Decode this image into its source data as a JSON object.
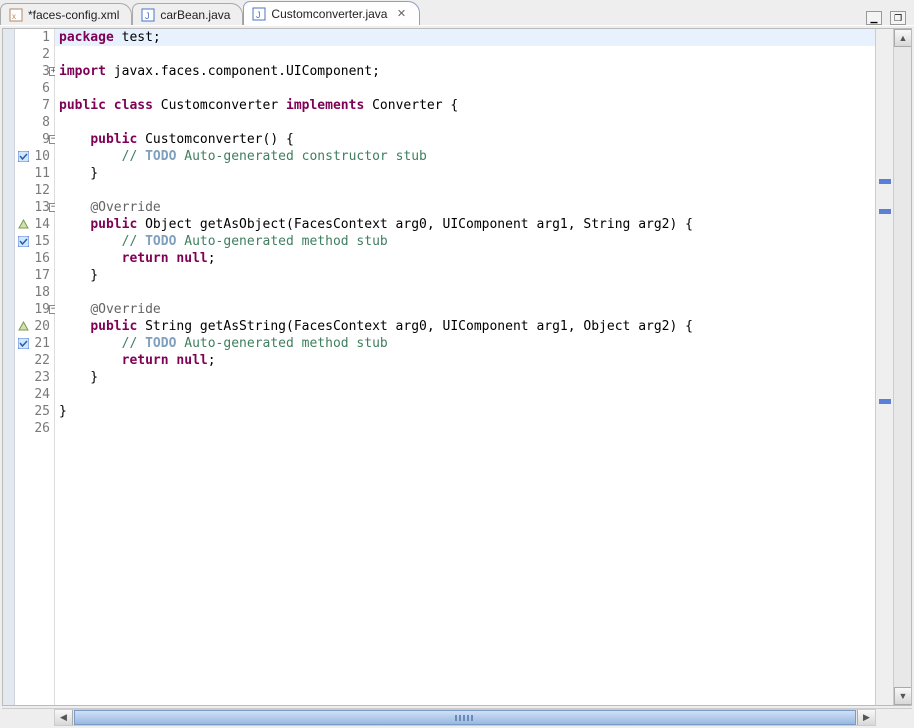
{
  "tabs": [
    {
      "label": "*faces-config.xml",
      "icon": "xml-file-icon",
      "active": false
    },
    {
      "label": "carBean.java",
      "icon": "java-file-icon",
      "active": false
    },
    {
      "label": "Customconverter.java",
      "icon": "java-file-icon",
      "active": true
    }
  ],
  "code": {
    "lines": [
      {
        "n": "1",
        "fold": "",
        "mark": "",
        "tokens": [
          [
            "kw",
            "package"
          ],
          [
            "",
            " test;"
          ]
        ],
        "cur": true
      },
      {
        "n": "2",
        "fold": "",
        "mark": "",
        "tokens": []
      },
      {
        "n": "3",
        "fold": "+",
        "mark": "",
        "tokens": [
          [
            "kw",
            "import"
          ],
          [
            "",
            " javax.faces.component.UIComponent;"
          ]
        ]
      },
      {
        "n": "6",
        "fold": "",
        "mark": "",
        "tokens": []
      },
      {
        "n": "7",
        "fold": "",
        "mark": "",
        "tokens": [
          [
            "kw",
            "public"
          ],
          [
            "",
            " "
          ],
          [
            "kw",
            "class"
          ],
          [
            "",
            " Customconverter "
          ],
          [
            "kw",
            "implements"
          ],
          [
            "",
            " Converter {"
          ]
        ]
      },
      {
        "n": "8",
        "fold": "",
        "mark": "",
        "tokens": []
      },
      {
        "n": "9",
        "fold": "-",
        "mark": "",
        "tokens": [
          [
            "",
            "    "
          ],
          [
            "kw",
            "public"
          ],
          [
            "",
            " Customconverter() {"
          ]
        ]
      },
      {
        "n": "10",
        "fold": "",
        "mark": "chk",
        "tokens": [
          [
            "",
            "        "
          ],
          [
            "cmt",
            "// "
          ],
          [
            "todo",
            "TODO"
          ],
          [
            "cmt",
            " Auto-generated constructor stub"
          ]
        ]
      },
      {
        "n": "11",
        "fold": "",
        "mark": "",
        "tokens": [
          [
            "",
            "    }"
          ]
        ]
      },
      {
        "n": "12",
        "fold": "",
        "mark": "",
        "tokens": []
      },
      {
        "n": "13",
        "fold": "-",
        "mark": "",
        "tokens": [
          [
            "",
            "    "
          ],
          [
            "ann",
            "@Override"
          ]
        ]
      },
      {
        "n": "14",
        "fold": "",
        "mark": "tri",
        "tokens": [
          [
            "",
            "    "
          ],
          [
            "kw",
            "public"
          ],
          [
            "",
            " Object getAsObject(FacesContext arg0, UIComponent arg1, String arg2) {"
          ]
        ]
      },
      {
        "n": "15",
        "fold": "",
        "mark": "chk",
        "tokens": [
          [
            "",
            "        "
          ],
          [
            "cmt",
            "// "
          ],
          [
            "todo",
            "TODO"
          ],
          [
            "cmt",
            " Auto-generated method stub"
          ]
        ]
      },
      {
        "n": "16",
        "fold": "",
        "mark": "",
        "tokens": [
          [
            "",
            "        "
          ],
          [
            "kw",
            "return"
          ],
          [
            "",
            " "
          ],
          [
            "kw",
            "null"
          ],
          [
            "",
            ";"
          ]
        ]
      },
      {
        "n": "17",
        "fold": "",
        "mark": "",
        "tokens": [
          [
            "",
            "    }"
          ]
        ]
      },
      {
        "n": "18",
        "fold": "",
        "mark": "",
        "tokens": []
      },
      {
        "n": "19",
        "fold": "-",
        "mark": "",
        "tokens": [
          [
            "",
            "    "
          ],
          [
            "ann",
            "@Override"
          ]
        ]
      },
      {
        "n": "20",
        "fold": "",
        "mark": "tri",
        "tokens": [
          [
            "",
            "    "
          ],
          [
            "kw",
            "public"
          ],
          [
            "",
            " String getAsString(FacesContext arg0, UIComponent arg1, Object arg2) {"
          ]
        ]
      },
      {
        "n": "21",
        "fold": "",
        "mark": "chk",
        "tokens": [
          [
            "",
            "        "
          ],
          [
            "cmt",
            "// "
          ],
          [
            "todo",
            "TODO"
          ],
          [
            "cmt",
            " Auto-generated method stub"
          ]
        ]
      },
      {
        "n": "22",
        "fold": "",
        "mark": "",
        "tokens": [
          [
            "",
            "        "
          ],
          [
            "kw",
            "return"
          ],
          [
            "",
            " "
          ],
          [
            "kw",
            "null"
          ],
          [
            "",
            ";"
          ]
        ]
      },
      {
        "n": "23",
        "fold": "",
        "mark": "",
        "tokens": [
          [
            "",
            "    }"
          ]
        ]
      },
      {
        "n": "24",
        "fold": "",
        "mark": "",
        "tokens": []
      },
      {
        "n": "25",
        "fold": "",
        "mark": "",
        "tokens": [
          [
            "",
            "}"
          ]
        ]
      },
      {
        "n": "26",
        "fold": "",
        "mark": "",
        "tokens": []
      }
    ]
  },
  "overview_markers": [
    150,
    180,
    370
  ],
  "window_buttons": {
    "minimize": "▁",
    "maximize": "❐"
  }
}
